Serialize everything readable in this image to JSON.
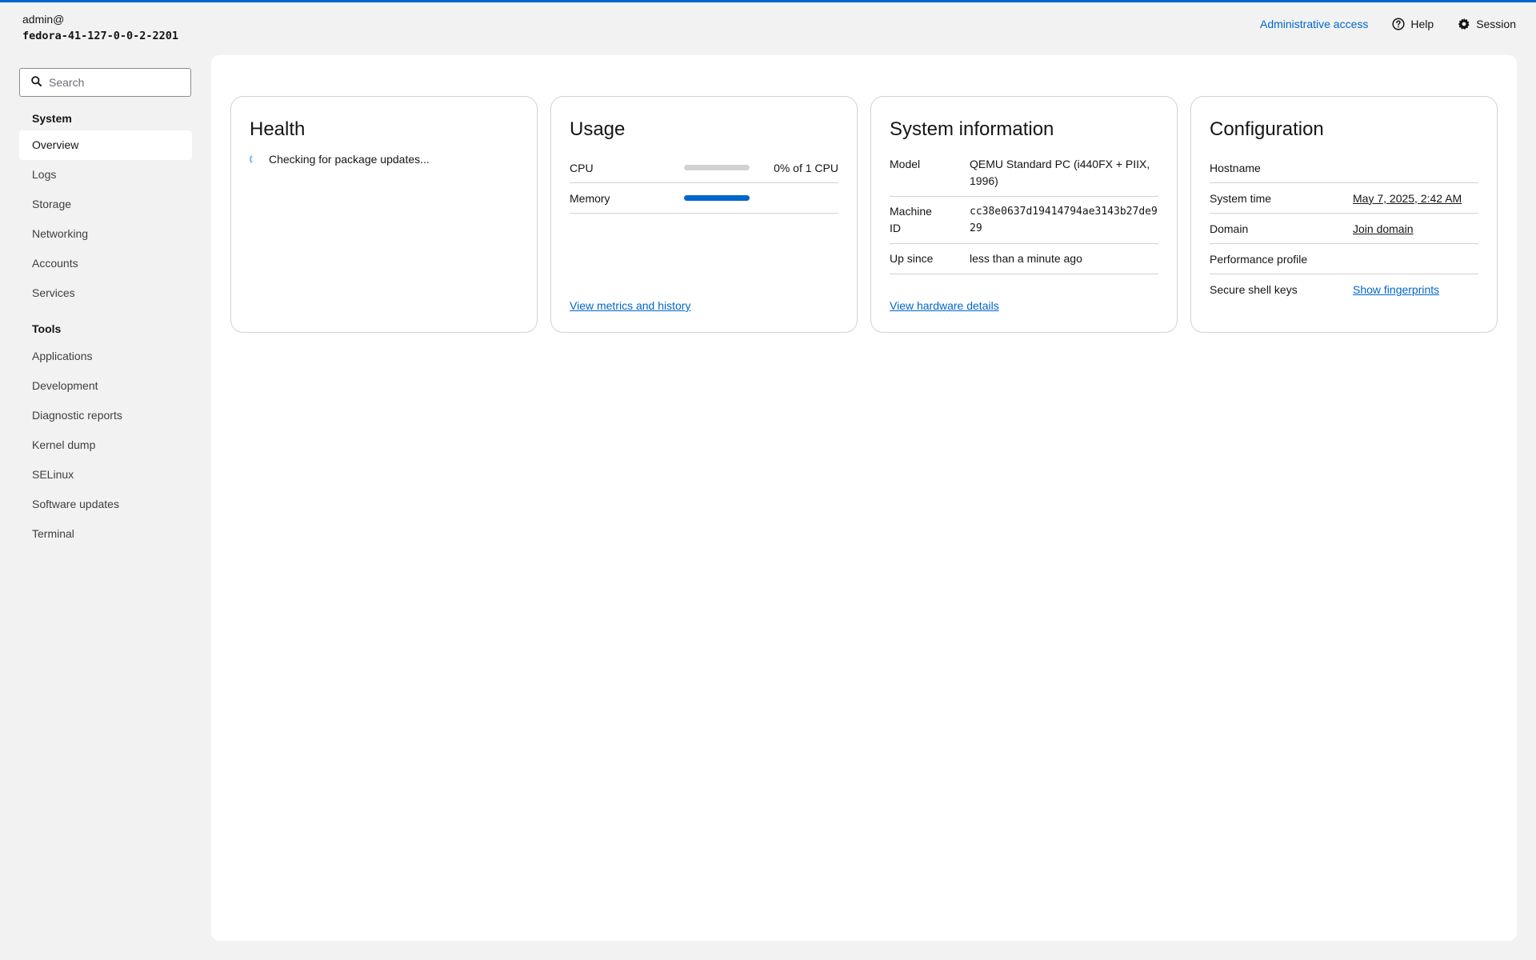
{
  "header": {
    "user": "admin@",
    "hostname": "fedora-41-127-0-0-2-2201",
    "admin_access": "Administrative access",
    "help": "Help",
    "session": "Session"
  },
  "search": {
    "placeholder": "Search"
  },
  "nav": {
    "system_title": "System",
    "system_items": [
      "Overview",
      "Logs",
      "Storage",
      "Networking",
      "Accounts",
      "Services"
    ],
    "active": "Overview",
    "tools_title": "Tools",
    "tools_items": [
      "Applications",
      "Development",
      "Diagnostic reports",
      "Kernel dump",
      "SELinux",
      "Software updates",
      "Terminal"
    ]
  },
  "health": {
    "title": "Health",
    "status": "Checking for package updates..."
  },
  "usage": {
    "title": "Usage",
    "cpu_label": "CPU",
    "cpu_value": "0% of 1 CPU",
    "cpu_fraction": 0.0,
    "memory_label": "Memory",
    "memory_fraction": 1.0,
    "link": "View metrics and history"
  },
  "sysinfo": {
    "title": "System information",
    "model_label": "Model",
    "model_value": "QEMU Standard PC (i440FX + PIIX, 1996)",
    "machine_id_label": "Machine ID",
    "machine_id_value": "cc38e0637d19414794ae3143b27de929",
    "up_since_label": "Up since",
    "up_since_value": "less than a minute ago",
    "link": "View hardware details"
  },
  "config": {
    "title": "Configuration",
    "hostname_label": "Hostname",
    "hostname_value": "",
    "system_time_label": "System time",
    "system_time_value": "May 7, 2025, 2:42 AM",
    "domain_label": "Domain",
    "domain_value": "Join domain",
    "performance_label": "Performance profile",
    "performance_value": "",
    "ssh_label": "Secure shell keys",
    "ssh_value": "Show fingerprints"
  },
  "colors": {
    "accent": "#0066cc",
    "background": "#f2f2f2"
  }
}
